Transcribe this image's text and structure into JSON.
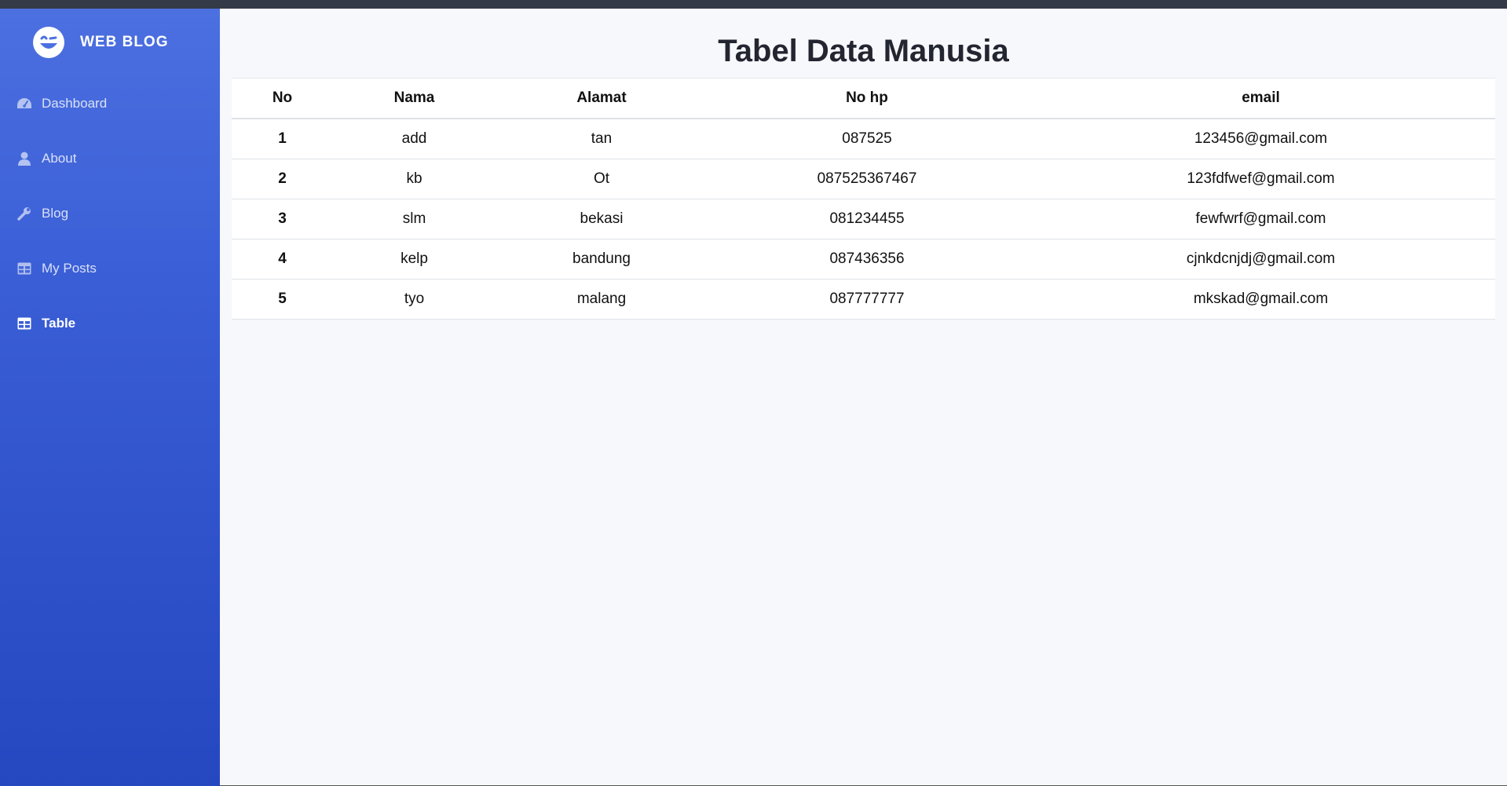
{
  "brand": {
    "name": "WEB BLOG",
    "logo_icon": "grinning-face-icon"
  },
  "sidebar": {
    "items": [
      {
        "label": "Dashboard",
        "icon": "gauge-icon",
        "active": false
      },
      {
        "label": "About",
        "icon": "user-icon",
        "active": false
      },
      {
        "label": "Blog",
        "icon": "wrench-icon",
        "active": false
      },
      {
        "label": "My Posts",
        "icon": "table-icon",
        "active": false
      },
      {
        "label": "Table",
        "icon": "table-icon",
        "active": true
      }
    ]
  },
  "main": {
    "title": "Tabel Data Manusia",
    "table": {
      "headers": [
        "No",
        "Nama",
        "Alamat",
        "No hp",
        "email"
      ],
      "rows": [
        [
          "1",
          "add",
          "tan",
          "087525",
          "123456@gmail.com"
        ],
        [
          "2",
          "kb",
          "Ot",
          "087525367467",
          "123fdfwef@gmail.com"
        ],
        [
          "3",
          "slm",
          "bekasi",
          "081234455",
          "fewfwrf@gmail.com"
        ],
        [
          "4",
          "kelp",
          "bandung",
          "087436356",
          "cjnkdcnjdj@gmail.com"
        ],
        [
          "5",
          "tyo",
          "malang",
          "087777777",
          "mkskad@gmail.com"
        ]
      ]
    }
  },
  "colors": {
    "sidebar_top": "#4c70e0",
    "sidebar_bottom": "#2547c0",
    "main_bg": "#f7f8fc"
  }
}
